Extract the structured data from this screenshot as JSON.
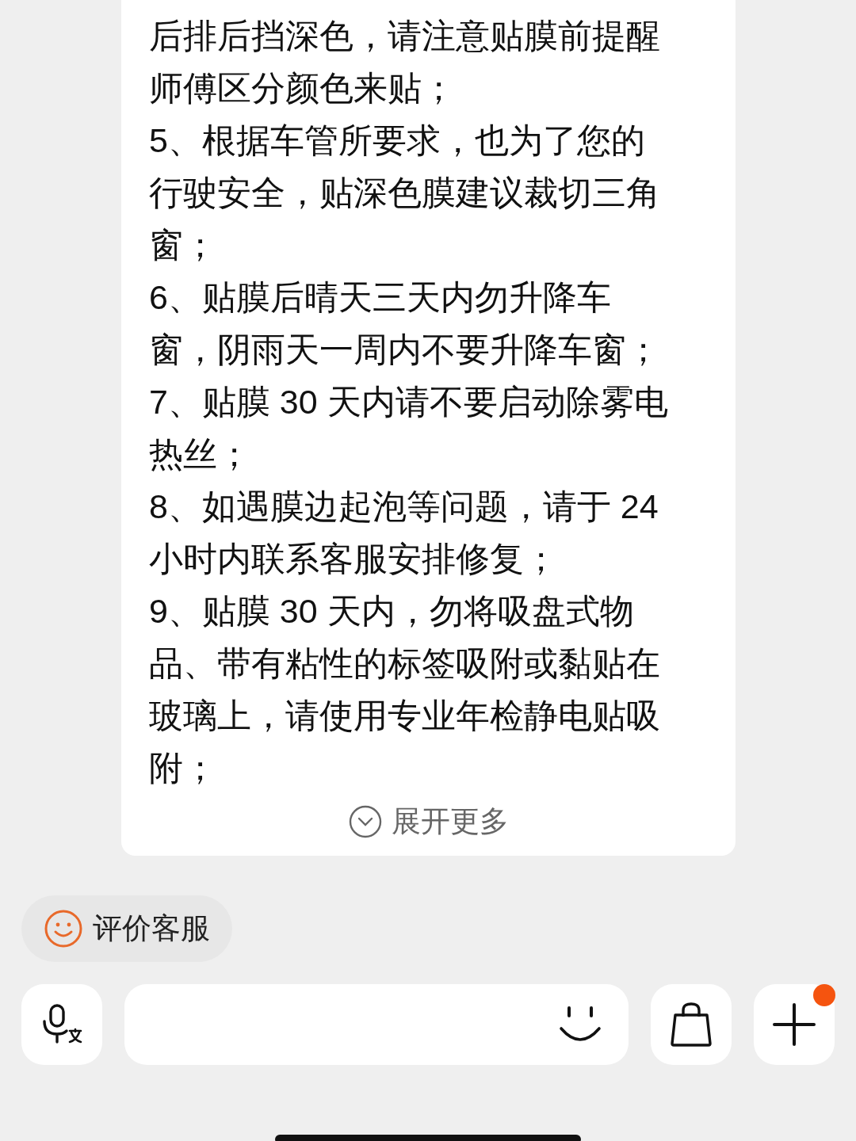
{
  "message": {
    "paragraphs": [
      {
        "lines": [
          "后排后挡深色，请注意贴膜前提醒",
          "师傅区分颜色来贴；"
        ]
      },
      {
        "lines": [
          "5、根据车管所要求，也为了您的",
          "行驶安全，贴深色膜建议裁切三角",
          "窗；"
        ]
      },
      {
        "lines": [
          "6、贴膜后晴天三天内勿升降车",
          "窗，阴雨天一周内不要升降车窗；"
        ]
      },
      {
        "lines": [
          "7、贴膜 30 天内请不要启动除雾电",
          "热丝；"
        ]
      },
      {
        "lines": [
          "8、如遇膜边起泡等问题，请于 24",
          "小时内联系客服安排修复；"
        ]
      },
      {
        "lines": [
          "9、贴膜 30 天内，勿将吸盘式物",
          "品、带有粘性的标签吸附或黏贴在",
          "玻璃上，请使用专业年检静电贴吸",
          "附；"
        ]
      }
    ],
    "expand_label": "展开更多"
  },
  "rate_chip": {
    "label": "评价客服"
  },
  "composer": {
    "more_button": {
      "has_notification": true
    }
  }
}
